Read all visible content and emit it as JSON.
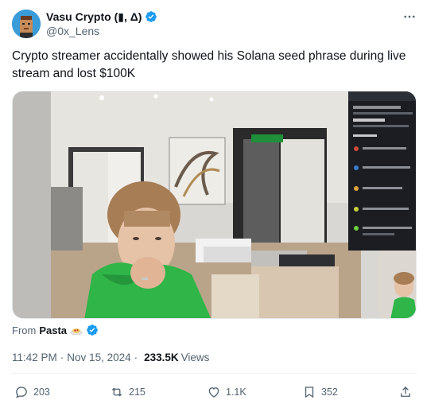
{
  "author": {
    "display_name": "Vasu Crypto (▮, Δ)",
    "handle": "@0x_Lens"
  },
  "tweet": {
    "text": "Crypto streamer accidentally showed his Solana seed phrase during live stream and lost $100K"
  },
  "source": {
    "from_label": "From",
    "name": "Pasta"
  },
  "meta": {
    "time": "11:42 PM",
    "separator": "·",
    "date": "Nov 15, 2024",
    "views_count": "233.5K",
    "views_label": "Views"
  },
  "actions": {
    "replies": "203",
    "reposts": "215",
    "likes": "1.1K",
    "bookmarks": "352"
  },
  "colors": {
    "verified": "#1d9bf0",
    "muted": "#536471",
    "hoodie": "#2fb548"
  }
}
